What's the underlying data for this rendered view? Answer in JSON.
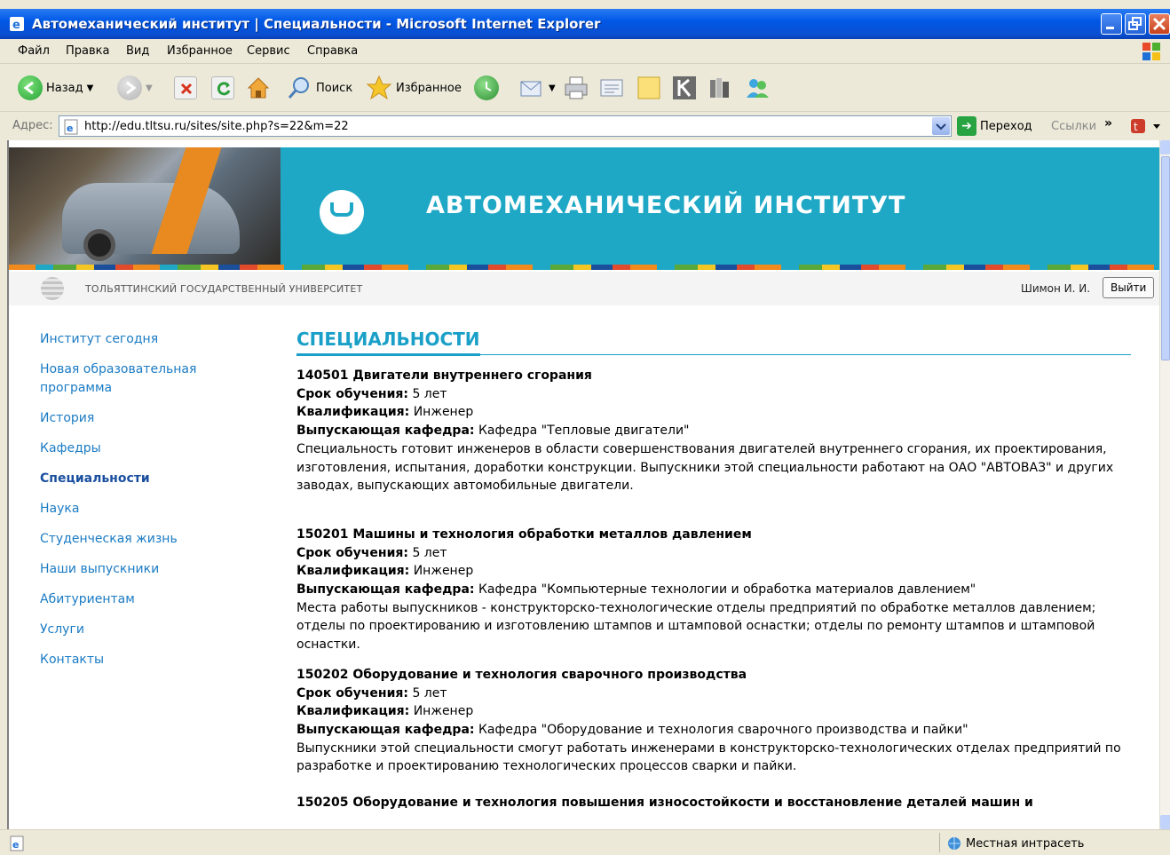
{
  "window": {
    "title": "Автомеханический институт | Специальности - Microsoft Internet Explorer"
  },
  "menu": [
    "Файл",
    "Правка",
    "Вид",
    "Избранное",
    "Сервис",
    "Справка"
  ],
  "toolbar": {
    "back_label": "Назад",
    "search_label": "Поиск",
    "favorites_label": "Избранное"
  },
  "address": {
    "label": "Адрес:",
    "url": "http://edu.tltsu.ru/sites/site.php?s=22&m=22",
    "go_label": "Переход",
    "links_label": "Ссылки",
    "chevron": "»"
  },
  "banner": {
    "title": "АВТОМЕХАНИЧЕСКИЙ ИНСТИТУТ",
    "university": "ТОЛЬЯТТИНСКИЙ ГОСУДАРСТВЕННЫЙ УНИВЕРСИТЕТ",
    "user": "Шимон И. И.",
    "logout_label": "Выйти"
  },
  "sidebar": {
    "items": [
      {
        "label": "Институт сегодня"
      },
      {
        "label": "Новая образовательная программа"
      },
      {
        "label": "История"
      },
      {
        "label": "Кафедры"
      },
      {
        "label": "Специальности"
      },
      {
        "label": "Наука"
      },
      {
        "label": "Студенческая жизнь"
      },
      {
        "label": "Наши выпускники"
      },
      {
        "label": "Абитуриентам"
      },
      {
        "label": "Услуги"
      },
      {
        "label": "Контакты"
      }
    ],
    "active_index": 4
  },
  "main": {
    "heading": "СПЕЦИАЛЬНОСТИ",
    "labels": {
      "duration": "Срок обучения:",
      "qualification": "Квалификация:",
      "department": "Выпускающая кафедра:"
    },
    "specialties": [
      {
        "title": "140501 Двигатели внутреннего сгорания",
        "duration": "5 лет",
        "qualification": "Инженер",
        "department": "Кафедра \"Тепловые двигатели\"",
        "description": "Специальность готовит инженеров в области совершенствования двигателей внутреннего сгорания, их проектирования, изготовления, испытания, доработки конструкции. Выпускники этой специальности работают на ОАО \"АВТОВАЗ\" и других заводах, выпускающих автомобильные двигатели."
      },
      {
        "title": "150201 Машины и технология обработки металлов давлением",
        "duration": "5 лет",
        "qualification": "Инженер",
        "department": "Кафедра \"Компьютерные технологии и обработка материалов давлением\"",
        "description": "Места работы выпускников - конструкторско-технологические отделы предприятий по обработке металлов давлением; отделы по проектированию и изготовлению штампов и штамповой оснастки; отделы по ремонту штампов и штамповой оснастки."
      },
      {
        "title": "150202 Оборудование и технология сварочного производства",
        "duration": "5 лет",
        "qualification": "Инженер",
        "department": "Кафедра \"Оборудование и технология сварочного производства и пайки\"",
        "description": "Выпускники этой специальности смогут работать инженерами в конструкторско-технологических отделах предприятий по разработке и проектированию технологических процессов сварки и пайки."
      },
      {
        "title": "150205 Оборудование и технология повышения износостойкости и восстановление деталей машин и"
      }
    ]
  },
  "status": {
    "zone": "Местная интрасеть"
  },
  "colors": {
    "banner": "#1ea8c6",
    "nav_link": "#1b7bc4",
    "heading": "#1aa0c8",
    "xp_title": "#0058e6"
  }
}
